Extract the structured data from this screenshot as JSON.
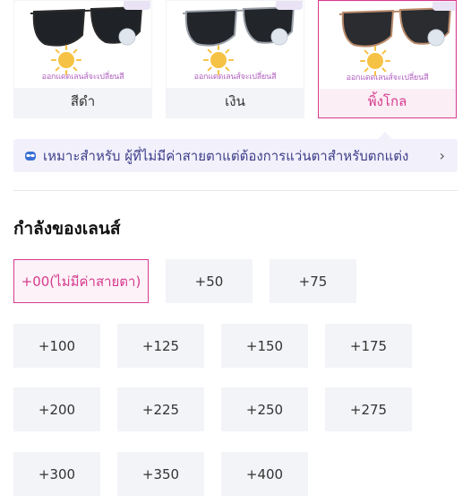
{
  "swatches": [
    {
      "label": "สีดำ",
      "tagline": "ออกแดดเลนส์จะเปลี่ยนสี",
      "selected": false,
      "frame_color": "#2a2a2a",
      "lens_color": "#1f2226"
    },
    {
      "label": "เงิน",
      "tagline": "ออกแดดเลนส์จะเปลี่ยนสี",
      "selected": false,
      "frame_color": "#9aa0a8",
      "lens_color": "#22252a"
    },
    {
      "label": "พิ้งโกล",
      "tagline": "ออกแดดเลนส์จะเปลี่ยนสี",
      "selected": true,
      "frame_color": "#b98a6a",
      "lens_color": "#2a2c30"
    }
  ],
  "notice": {
    "text": "เหมาะสำหรับ ผู้ที่ไม่มีค่าสายตาแต่ต้องการแว่นตาสำหรับตกแต่ง",
    "chevron": "›"
  },
  "section": {
    "title": "กำลังของเลนส์"
  },
  "powers": [
    {
      "label": "+00(ไม่มีค่าสายตา)",
      "selected": true
    },
    {
      "label": "+50",
      "selected": false
    },
    {
      "label": "+75",
      "selected": false
    },
    {
      "label": "+100",
      "selected": false
    },
    {
      "label": "+125",
      "selected": false
    },
    {
      "label": "+150",
      "selected": false
    },
    {
      "label": "+175",
      "selected": false
    },
    {
      "label": "+200",
      "selected": false
    },
    {
      "label": "+225",
      "selected": false
    },
    {
      "label": "+250",
      "selected": false
    },
    {
      "label": "+275",
      "selected": false
    },
    {
      "label": "+300",
      "selected": false
    },
    {
      "label": "+350",
      "selected": false
    },
    {
      "label": "+400",
      "selected": false
    }
  ],
  "colors": {
    "accent": "#d63b8f",
    "notice_bg": "#f2f1fb",
    "option_bg": "#f3f4f7"
  }
}
